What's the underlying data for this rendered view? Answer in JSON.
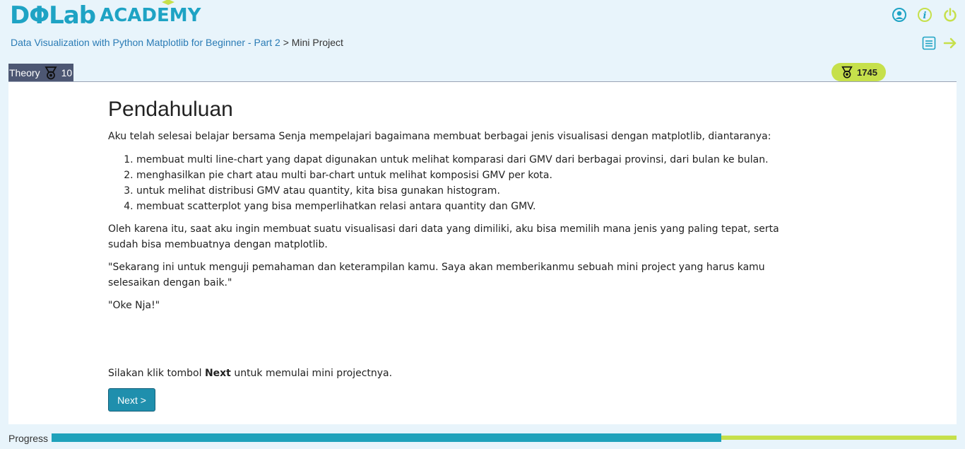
{
  "brand": {
    "logo_text": "DΦLab",
    "academy_text": "ACADEMY"
  },
  "header_icons": [
    "user-circle-icon",
    "info-icon",
    "power-icon"
  ],
  "breadcrumb": {
    "course": "Data Visualization with Python Matplotlib for Beginner - Part 2",
    "separator": " > ",
    "current": "Mini Project"
  },
  "side_icons": [
    "list-icon",
    "arrow-right-icon"
  ],
  "theory_tab": {
    "label": "Theory",
    "count": "10"
  },
  "points": "1745",
  "lesson": {
    "title": "Pendahuluan",
    "intro": "Aku telah selesai belajar bersama Senja mempelajari bagaimana membuat berbagai jenis visualisasi dengan matplotlib, diantaranya:",
    "items": [
      "membuat multi line-chart yang dapat digunakan untuk melihat komparasi dari GMV dari berbagai provinsi, dari bulan ke bulan.",
      "menghasilkan pie chart atau multi bar-chart untuk melihat komposisi GMV per kota.",
      "untuk melihat distribusi GMV atau quantity, kita bisa gunakan histogram.",
      "membuat scatterplot yang bisa memperlihatkan relasi antara quantity dan GMV."
    ],
    "para2": "Oleh karena itu, saat aku ingin membuat suatu visualisasi dari data yang dimiliki, aku bisa memilih mana jenis yang paling tepat, serta sudah bisa membuatnya dengan matplotlib.",
    "para3": "\"Sekarang ini untuk menguji pemahaman dan keterampilan kamu. Saya akan memberikanmu sebuah mini project yang harus kamu selesaikan dengan baik.\"",
    "para4": "\"Oke Nja!\"",
    "instruction_pre": "Silakan klik tombol ",
    "instruction_bold": "Next",
    "instruction_post": " untuk memulai mini projectnya."
  },
  "next_button": "Next >",
  "progress": {
    "label": "Progress",
    "fraction": 0.74
  },
  "colors": {
    "primary": "#1ea3c4",
    "accent": "#c6e04b",
    "tab": "#4d5773",
    "button": "#1f8fad"
  }
}
